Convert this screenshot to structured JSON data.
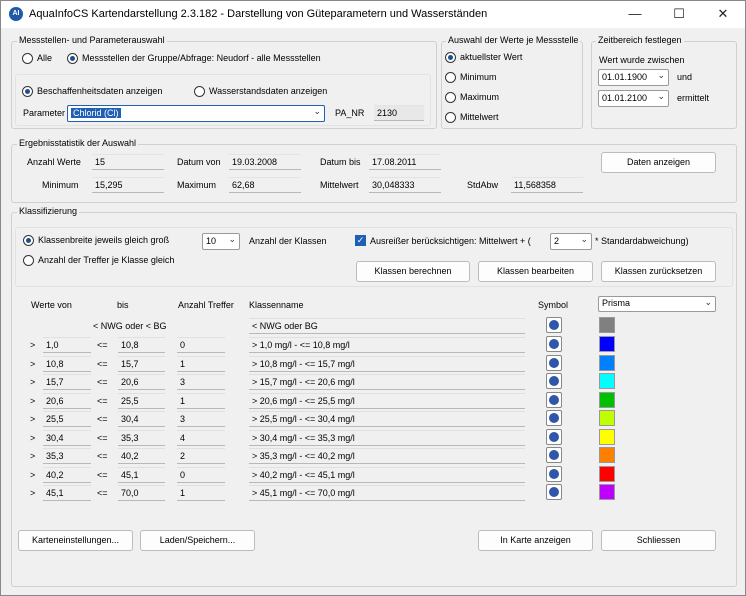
{
  "window": {
    "icon_text": "AI",
    "title": "AquaInfoCS Kartendarstellung 2.3.182  - Darstellung von Güteparametern und Wasserständen",
    "minimize": "—",
    "maximize": "☐",
    "close": "✕"
  },
  "station_group": {
    "title": "Messstellen- und Parameterauswahl",
    "radio_all": "Alle",
    "radio_group": "Messstellen der Gruppe/Abfrage: Neudorf - alle Messstellen",
    "radio_quality": "Beschaffenheitsdaten anzeigen",
    "radio_water": "Wasserstandsdaten anzeigen",
    "param_label": "Parameter",
    "param_value": "Chlorid (Cl)",
    "pa_nr_label": "PA_NR",
    "pa_nr_value": "2130"
  },
  "values_group": {
    "title": "Auswahl der Werte je Messstelle",
    "options": [
      "aktuellster Wert",
      "Minimum",
      "Maximum",
      "Mittelwert"
    ]
  },
  "time_group": {
    "title": "Zeitbereich festlegen",
    "caption": "Wert wurde zwischen",
    "from": "01.01.1900",
    "and_label": "und",
    "to": "01.01.2100",
    "suffix": "ermittelt"
  },
  "stats": {
    "title": "Ergebnisstatistik der Auswahl",
    "count_label": "Anzahl Werte",
    "count": "15",
    "date_from_label": "Datum von",
    "date_from": "19.03.2008",
    "date_to_label": "Datum bis",
    "date_to": "17.08.2011",
    "show_button": "Daten anzeigen",
    "min_label": "Minimum",
    "min": "15,295",
    "max_label": "Maximum",
    "max": "62,68",
    "mean_label": "Mittelwert",
    "mean": "30,048333",
    "std_label": "StdAbw",
    "std": "11,568358"
  },
  "classify": {
    "title": "Klassifizierung",
    "radio_equal_width": "Klassenbreite jeweils gleich groß",
    "radio_equal_count": "Anzahl der Treffer je Klasse gleich",
    "class_count": "10",
    "class_count_label": "Anzahl der Klassen",
    "outlier_label": "Ausreißer berücksichtigen: Mittelwert + (",
    "outlier_value": "2",
    "outlier_suffix": "* Standardabweichung)",
    "btn_calc": "Klassen berechnen",
    "btn_edit": "Klassen bearbeiten",
    "btn_reset": "Klassen zurücksetzen",
    "headers": {
      "from": "Werte von",
      "to": "bis",
      "hits": "Anzahl Treffer",
      "name": "Klassenname",
      "symbol": "Symbol"
    },
    "palette": "Prisma",
    "special_row": {
      "range": "< NWG oder < BG",
      "name": "< NWG oder BG",
      "color": "#808080"
    },
    "rows": [
      {
        "gt": ">",
        "from": "1,0",
        "le": "<=",
        "to": "10,8",
        "hits": "0",
        "name": "> 1,0 mg/l - <= 10,8 mg/l",
        "color": "#0000ff"
      },
      {
        "gt": ">",
        "from": "10,8",
        "le": "<=",
        "to": "15,7",
        "hits": "1",
        "name": "> 10,8 mg/l - <= 15,7 mg/l",
        "color": "#0080ff"
      },
      {
        "gt": ">",
        "from": "15,7",
        "le": "<=",
        "to": "20,6",
        "hits": "3",
        "name": "> 15,7 mg/l - <= 20,6 mg/l",
        "color": "#00ffff"
      },
      {
        "gt": ">",
        "from": "20,6",
        "le": "<=",
        "to": "25,5",
        "hits": "1",
        "name": "> 20,6 mg/l - <= 25,5 mg/l",
        "color": "#00c000"
      },
      {
        "gt": ">",
        "from": "25,5",
        "le": "<=",
        "to": "30,4",
        "hits": "3",
        "name": "> 25,5 mg/l - <= 30,4 mg/l",
        "color": "#c0ff00"
      },
      {
        "gt": ">",
        "from": "30,4",
        "le": "<=",
        "to": "35,3",
        "hits": "4",
        "name": "> 30,4 mg/l - <= 35,3 mg/l",
        "color": "#ffff00"
      },
      {
        "gt": ">",
        "from": "35,3",
        "le": "<=",
        "to": "40,2",
        "hits": "2",
        "name": "> 35,3 mg/l - <= 40,2 mg/l",
        "color": "#ff8000"
      },
      {
        "gt": ">",
        "from": "40,2",
        "le": "<=",
        "to": "45,1",
        "hits": "0",
        "name": "> 40,2 mg/l - <= 45,1 mg/l",
        "color": "#ff0000"
      },
      {
        "gt": ">",
        "from": "45,1",
        "le": "<=",
        "to": "70,0",
        "hits": "1",
        "name": "> 45,1 mg/l - <= 70,0 mg/l",
        "color": "#c000ff"
      }
    ]
  },
  "footer": {
    "map_settings": "Karteneinstellungen...",
    "load_save": "Laden/Speichern...",
    "show_map": "In Karte anzeigen",
    "close": "Schliessen"
  }
}
